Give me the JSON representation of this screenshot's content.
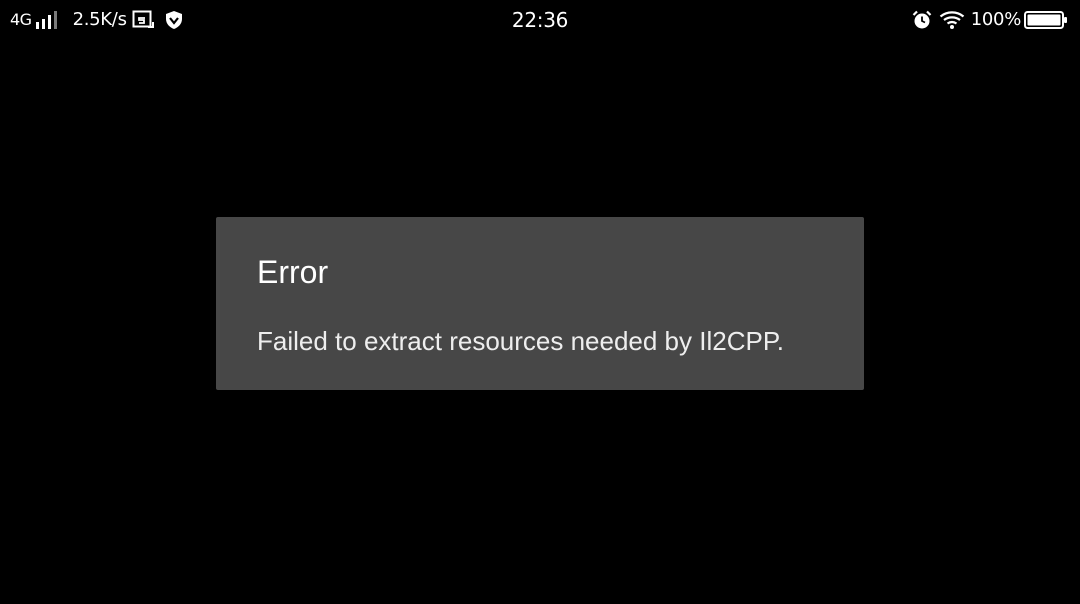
{
  "status_bar": {
    "network_type": "4G",
    "net_speed": "2.5K/s",
    "clock": "22:36",
    "battery_level": "100%",
    "battery_fraction": 1.0,
    "icons": {
      "signal": "signal-strength-icon",
      "screenshot": "screenshot-icon",
      "vpn": "vpn-shield-icon",
      "alarm": "alarm-clock-icon",
      "wifi": "wifi-icon",
      "battery": "battery-icon"
    }
  },
  "dialog": {
    "title": "Error",
    "message": "Failed to extract resources needed by Il2CPP."
  },
  "colors": {
    "background": "#000000",
    "dialog_background": "#474747",
    "text": "#ffffff"
  }
}
